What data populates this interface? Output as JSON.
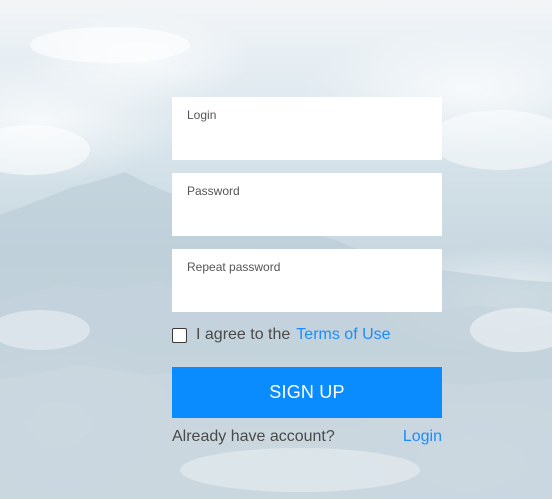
{
  "form": {
    "fields": [
      {
        "label": "Login",
        "value": ""
      },
      {
        "label": "Password",
        "value": ""
      },
      {
        "label": "Repeat password",
        "value": ""
      }
    ],
    "terms": {
      "checked": false,
      "text": "I agree to the",
      "link": "Terms of Use"
    },
    "submit_label": "SIGN UP",
    "footer": {
      "text": "Already have account?",
      "link": "Login"
    }
  },
  "colors": {
    "accent": "#0a8cff",
    "link": "#1a8cff",
    "field_bg": "#ffffff",
    "text_muted": "#4a4a4a"
  },
  "icons": {
    "checkbox": "unchecked-checkbox-icon"
  }
}
